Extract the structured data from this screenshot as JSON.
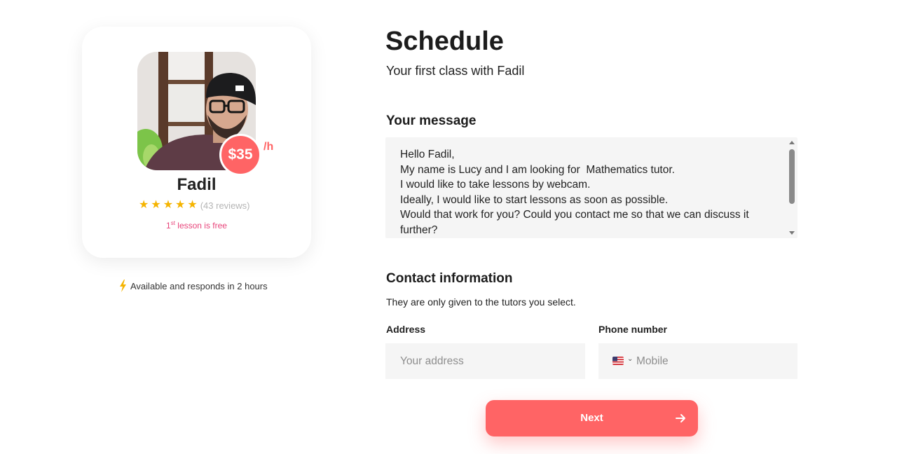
{
  "tutor": {
    "name": "Fadil",
    "price": "$35",
    "price_unit": "/h",
    "rating": 5,
    "reviews": "(43 reviews)",
    "free_ordinal": "1",
    "free_sup": "st",
    "free_text": " lesson is free",
    "availability": "Available and responds in 2 hours"
  },
  "schedule": {
    "title": "Schedule",
    "subtitle": "Your first class with Fadil"
  },
  "message": {
    "heading": "Your message",
    "value": "Hello Fadil,\nMy name is Lucy and I am looking for  Mathematics tutor.\nI would like to take lessons by webcam.\nIdeally, I would like to start lessons as soon as possible.\nWould that work for you? Could you contact me so that we can discuss it further?"
  },
  "contact": {
    "heading": "Contact information",
    "note": "They are only given to the tutors you select.",
    "address_label": "Address",
    "address_placeholder": "Your address",
    "phone_label": "Phone number",
    "phone_placeholder": "Mobile",
    "phone_country_icon": "us-flag-icon"
  },
  "actions": {
    "next_label": "Next"
  },
  "colors": {
    "accent": "#ff6465",
    "free_text": "#e8447a",
    "star": "#f5b400"
  }
}
